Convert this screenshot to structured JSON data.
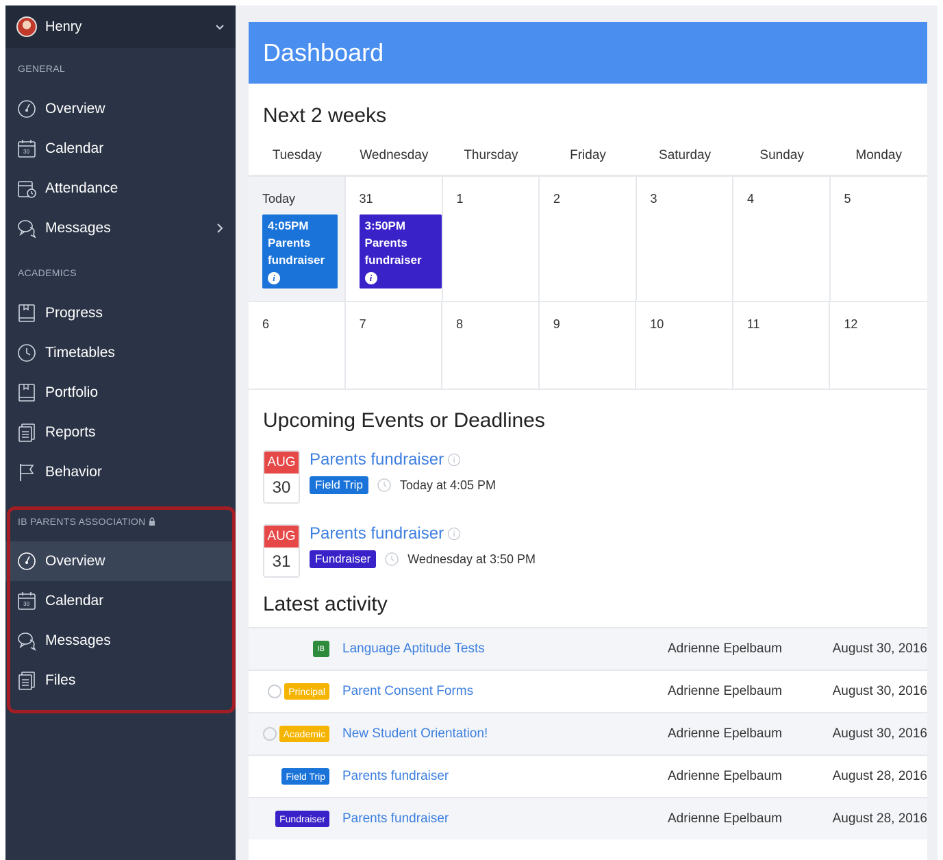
{
  "user": {
    "name": "Henry"
  },
  "sidebar": {
    "general_label": "GENERAL",
    "general": [
      {
        "label": "Overview",
        "icon": "dashboard-gauge-icon"
      },
      {
        "label": "Calendar",
        "icon": "calendar-icon"
      },
      {
        "label": "Attendance",
        "icon": "attendance-icon"
      },
      {
        "label": "Messages",
        "icon": "chat-bubbles-icon"
      }
    ],
    "academics_label": "ACADEMICS",
    "academics": [
      {
        "label": "Progress",
        "icon": "book-icon"
      },
      {
        "label": "Timetables",
        "icon": "clock-icon"
      },
      {
        "label": "Portfolio",
        "icon": "portfolio-icon"
      },
      {
        "label": "Reports",
        "icon": "documents-icon"
      },
      {
        "label": "Behavior",
        "icon": "flag-icon"
      }
    ],
    "group_label": "IB PARENTS ASSOCIATION",
    "group": [
      {
        "label": "Overview",
        "icon": "dashboard-gauge-icon"
      },
      {
        "label": "Calendar",
        "icon": "calendar-icon"
      },
      {
        "label": "Messages",
        "icon": "chat-bubbles-icon"
      },
      {
        "label": "Files",
        "icon": "documents-icon"
      }
    ],
    "highlight_color": "#a31d24"
  },
  "dashboard": {
    "title": "Dashboard",
    "next_title": "Next 2 weeks",
    "days": [
      "Tuesday",
      "Wednesday",
      "Thursday",
      "Friday",
      "Saturday",
      "Sunday",
      "Monday"
    ],
    "week1": [
      "Today",
      "31",
      "1",
      "2",
      "3",
      "4",
      "5"
    ],
    "week2": [
      "6",
      "7",
      "8",
      "9",
      "10",
      "11",
      "12"
    ],
    "cal_events": [
      {
        "time": "4:05PM",
        "line1": "Parents",
        "line2": "fundraiser",
        "info": "i"
      },
      {
        "time": "3:50PM",
        "line1": "Parents",
        "line2": "fundraiser",
        "info": "i"
      }
    ],
    "upcoming_title": "Upcoming Events or Deadlines",
    "upcoming": [
      {
        "month": "AUG",
        "day": "30",
        "title": "Parents fundraiser",
        "tag": "Field Trip",
        "when": "Today at 4:05 PM"
      },
      {
        "month": "AUG",
        "day": "31",
        "title": "Parents fundraiser",
        "tag": "Fundraiser",
        "when": "Wednesday at 3:50 PM"
      }
    ],
    "activity_title": "Latest activity",
    "activity": [
      {
        "badge": "IB",
        "title": "Language Aptitude Tests",
        "author": "Adrienne Epelbaum",
        "date": "August 30, 2016"
      },
      {
        "badge": "Principal",
        "title": "Parent Consent Forms",
        "author": "Adrienne Epelbaum",
        "date": "August 30, 2016"
      },
      {
        "badge": "Academic",
        "title": "New Student Orientation!",
        "author": "Adrienne Epelbaum",
        "date": "August 30, 2016"
      },
      {
        "badge": "Field Trip",
        "title": "Parents fundraiser",
        "author": "Adrienne Epelbaum",
        "date": "August 28, 2016"
      },
      {
        "badge": "Fundraiser",
        "title": "Parents fundraiser",
        "author": "Adrienne Epelbaum",
        "date": "August 28, 2016"
      }
    ],
    "colors": {
      "header": "#4a8ff0",
      "field_trip": "#1a73d9",
      "fundraiser": "#3a22c9",
      "date_badge": "#e64848",
      "principal": "#f5b400",
      "ib": "#2e8b3b"
    }
  }
}
